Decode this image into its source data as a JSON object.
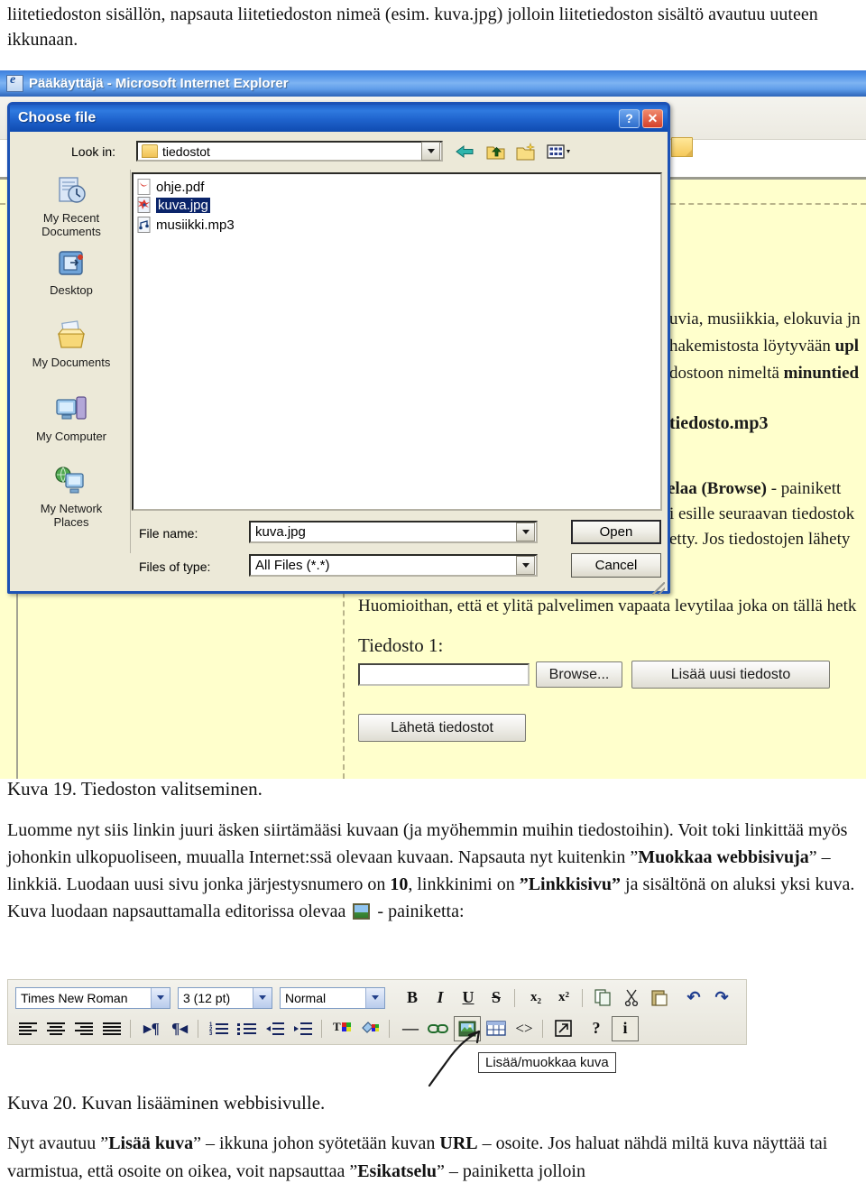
{
  "document": {
    "intro_paragraph": "liitetiedoston sisällön, napsauta liitetiedoston nimeä (esim. kuva.jpg) jolloin liitetiedoston sisältö avautuu uuteen ikkunaan.",
    "caption_19": "Kuva 19. Tiedoston valitseminen.",
    "caption_20": "Kuva 20. Kuvan lisääminen webbisivulle.",
    "paragraph_2": {
      "p1": "Luomme nyt siis linkin juuri äsken siirtämääsi kuvaan (ja myöhemmin muihin tiedostoihin). Voit toki linkittää myös johonkin ulkopuoliseen, muualla Internet:ssä olevaan kuvaan. Napsauta nyt kuitenkin ”",
      "b1": "Muokkaa webbisivuja",
      "p2": "” – linkkiä. Luodaan uusi sivu jonka järjestysnumero on ",
      "b2": "10",
      "p3": ", linkkinimi on ",
      "b3": "”Linkkisivu”",
      "p4": " ja sisältönä on aluksi yksi kuva. Kuva luodaan napsauttamalla editorissa olevaa ",
      "p5": " - painiketta:"
    },
    "paragraph_3": {
      "p1": "Nyt avautuu ”",
      "b1": "Lisää kuva",
      "p2": "” – ikkuna johon syötetään kuvan ",
      "b2": "URL",
      "p3": " – osoite. Jos haluat nähdä miltä kuva näyttää tai varmistua, että osoite on oikea, voit napsauttaa ”",
      "b3": "Esikatselu",
      "p4": "” – painiketta jolloin"
    }
  },
  "browser": {
    "title": "Pääkäyttäjä - Microsoft Internet Explorer",
    "icon": "ie-icon"
  },
  "dialog": {
    "title": "Choose file",
    "help_button": "?",
    "close_button": "✕",
    "lookin_label": "Look in:",
    "lookin_value": "tiedostot",
    "nav_icons": [
      "back-arrow-icon",
      "up-one-level-icon",
      "new-folder-icon",
      "views-icon"
    ],
    "places": [
      {
        "label_line1": "My Recent",
        "label_line2": "Documents",
        "icon": "recent-documents-icon"
      },
      {
        "label_line1": "Desktop",
        "label_line2": "",
        "icon": "desktop-icon"
      },
      {
        "label_line1": "My Documents",
        "label_line2": "",
        "icon": "my-documents-icon"
      },
      {
        "label_line1": "My Computer",
        "label_line2": "",
        "icon": "my-computer-icon"
      },
      {
        "label_line1": "My Network",
        "label_line2": "Places",
        "icon": "my-network-places-icon"
      }
    ],
    "files": [
      {
        "name": "ohje.pdf",
        "icon": "pdf-file-icon",
        "selected": false
      },
      {
        "name": "kuva.jpg",
        "icon": "jpg-file-icon",
        "selected": true
      },
      {
        "name": "musiikki.mp3",
        "icon": "mp3-file-icon",
        "selected": false
      }
    ],
    "filename_label": "File name:",
    "filename_value": "kuva.jpg",
    "filetype_label": "Files of type:",
    "filetype_value": "All Files (*.*)",
    "open_button": "Open",
    "cancel_button": "Cancel"
  },
  "page_behind": {
    "line1": "uvia, musiikkia, elokuvia jn",
    "line2_a": "hakemistosta löytyvään ",
    "line2_b": "upl",
    "line3_a": "dostoon nimeltä ",
    "line3_b": "minuntied",
    "line4": "tiedosto.mp3",
    "line5_a": "elaa (Browse)",
    "line5_b": " - painikett",
    "line6": "i esille seuraavan tiedostok",
    "line7": "etty. Jos tiedostojen lähety",
    "notice": "Huomioithan, että et ylitä palvelimen vapaata levytilaa joka on tällä hetk",
    "file_label": "Tiedosto 1:",
    "file_input_value": "",
    "browse_button": "Browse...",
    "add_file_button": "Lisää uusi tiedosto",
    "send_button": "Lähetä tiedostot"
  },
  "editor_toolbar": {
    "font_family": "Times New Roman",
    "font_size": "3 (12 pt)",
    "style": "Normal",
    "row1_icons": [
      {
        "name": "bold-icon",
        "glyph": "B"
      },
      {
        "name": "italic-icon",
        "glyph": "I"
      },
      {
        "name": "underline-icon",
        "glyph": "U"
      },
      {
        "name": "strikethrough-icon",
        "glyph": "S"
      },
      {
        "name": "subscript-icon",
        "glyph": "x₂"
      },
      {
        "name": "superscript-icon",
        "glyph": "x²"
      },
      {
        "name": "copy-icon",
        "glyph": "⎘"
      },
      {
        "name": "cut-icon",
        "glyph": "✂"
      },
      {
        "name": "paste-icon",
        "glyph": "📋"
      },
      {
        "name": "undo-icon",
        "glyph": "↶"
      },
      {
        "name": "redo-icon",
        "glyph": "↷"
      }
    ],
    "row2_icons": [
      {
        "name": "align-left-icon",
        "glyph": "≡"
      },
      {
        "name": "align-center-icon",
        "glyph": "≡"
      },
      {
        "name": "align-right-icon",
        "glyph": "≡"
      },
      {
        "name": "justify-icon",
        "glyph": "≡"
      },
      {
        "name": "ltr-direction-icon",
        "glyph": "▸¶"
      },
      {
        "name": "rtl-direction-icon",
        "glyph": "¶◂"
      },
      {
        "name": "ordered-list-icon",
        "glyph": "⒈"
      },
      {
        "name": "unordered-list-icon",
        "glyph": "•"
      },
      {
        "name": "outdent-icon",
        "glyph": "⇤"
      },
      {
        "name": "indent-icon",
        "glyph": "⇥"
      },
      {
        "name": "text-color-icon",
        "glyph": "T"
      },
      {
        "name": "background-color-icon",
        "glyph": "◆"
      },
      {
        "name": "horizontal-rule-icon",
        "glyph": "—"
      },
      {
        "name": "insert-link-icon",
        "glyph": "∞"
      },
      {
        "name": "insert-image-icon",
        "glyph": "🖼"
      },
      {
        "name": "insert-table-icon",
        "glyph": "▦"
      },
      {
        "name": "source-code-icon",
        "glyph": "<>"
      },
      {
        "name": "popup-editor-icon",
        "glyph": "↗"
      },
      {
        "name": "help-icon",
        "glyph": "?"
      },
      {
        "name": "info-icon",
        "glyph": "i"
      }
    ],
    "tooltip": "Lisää/muokkaa kuva"
  },
  "colors": {
    "dialog_titlebar": "#1f63cd",
    "dialog_face": "#ece9d8",
    "dialog_border": "#1c52b5",
    "page_background": "#ffffcc",
    "selection": "#0a246a",
    "ie_titlebar": "#4f92e8"
  }
}
